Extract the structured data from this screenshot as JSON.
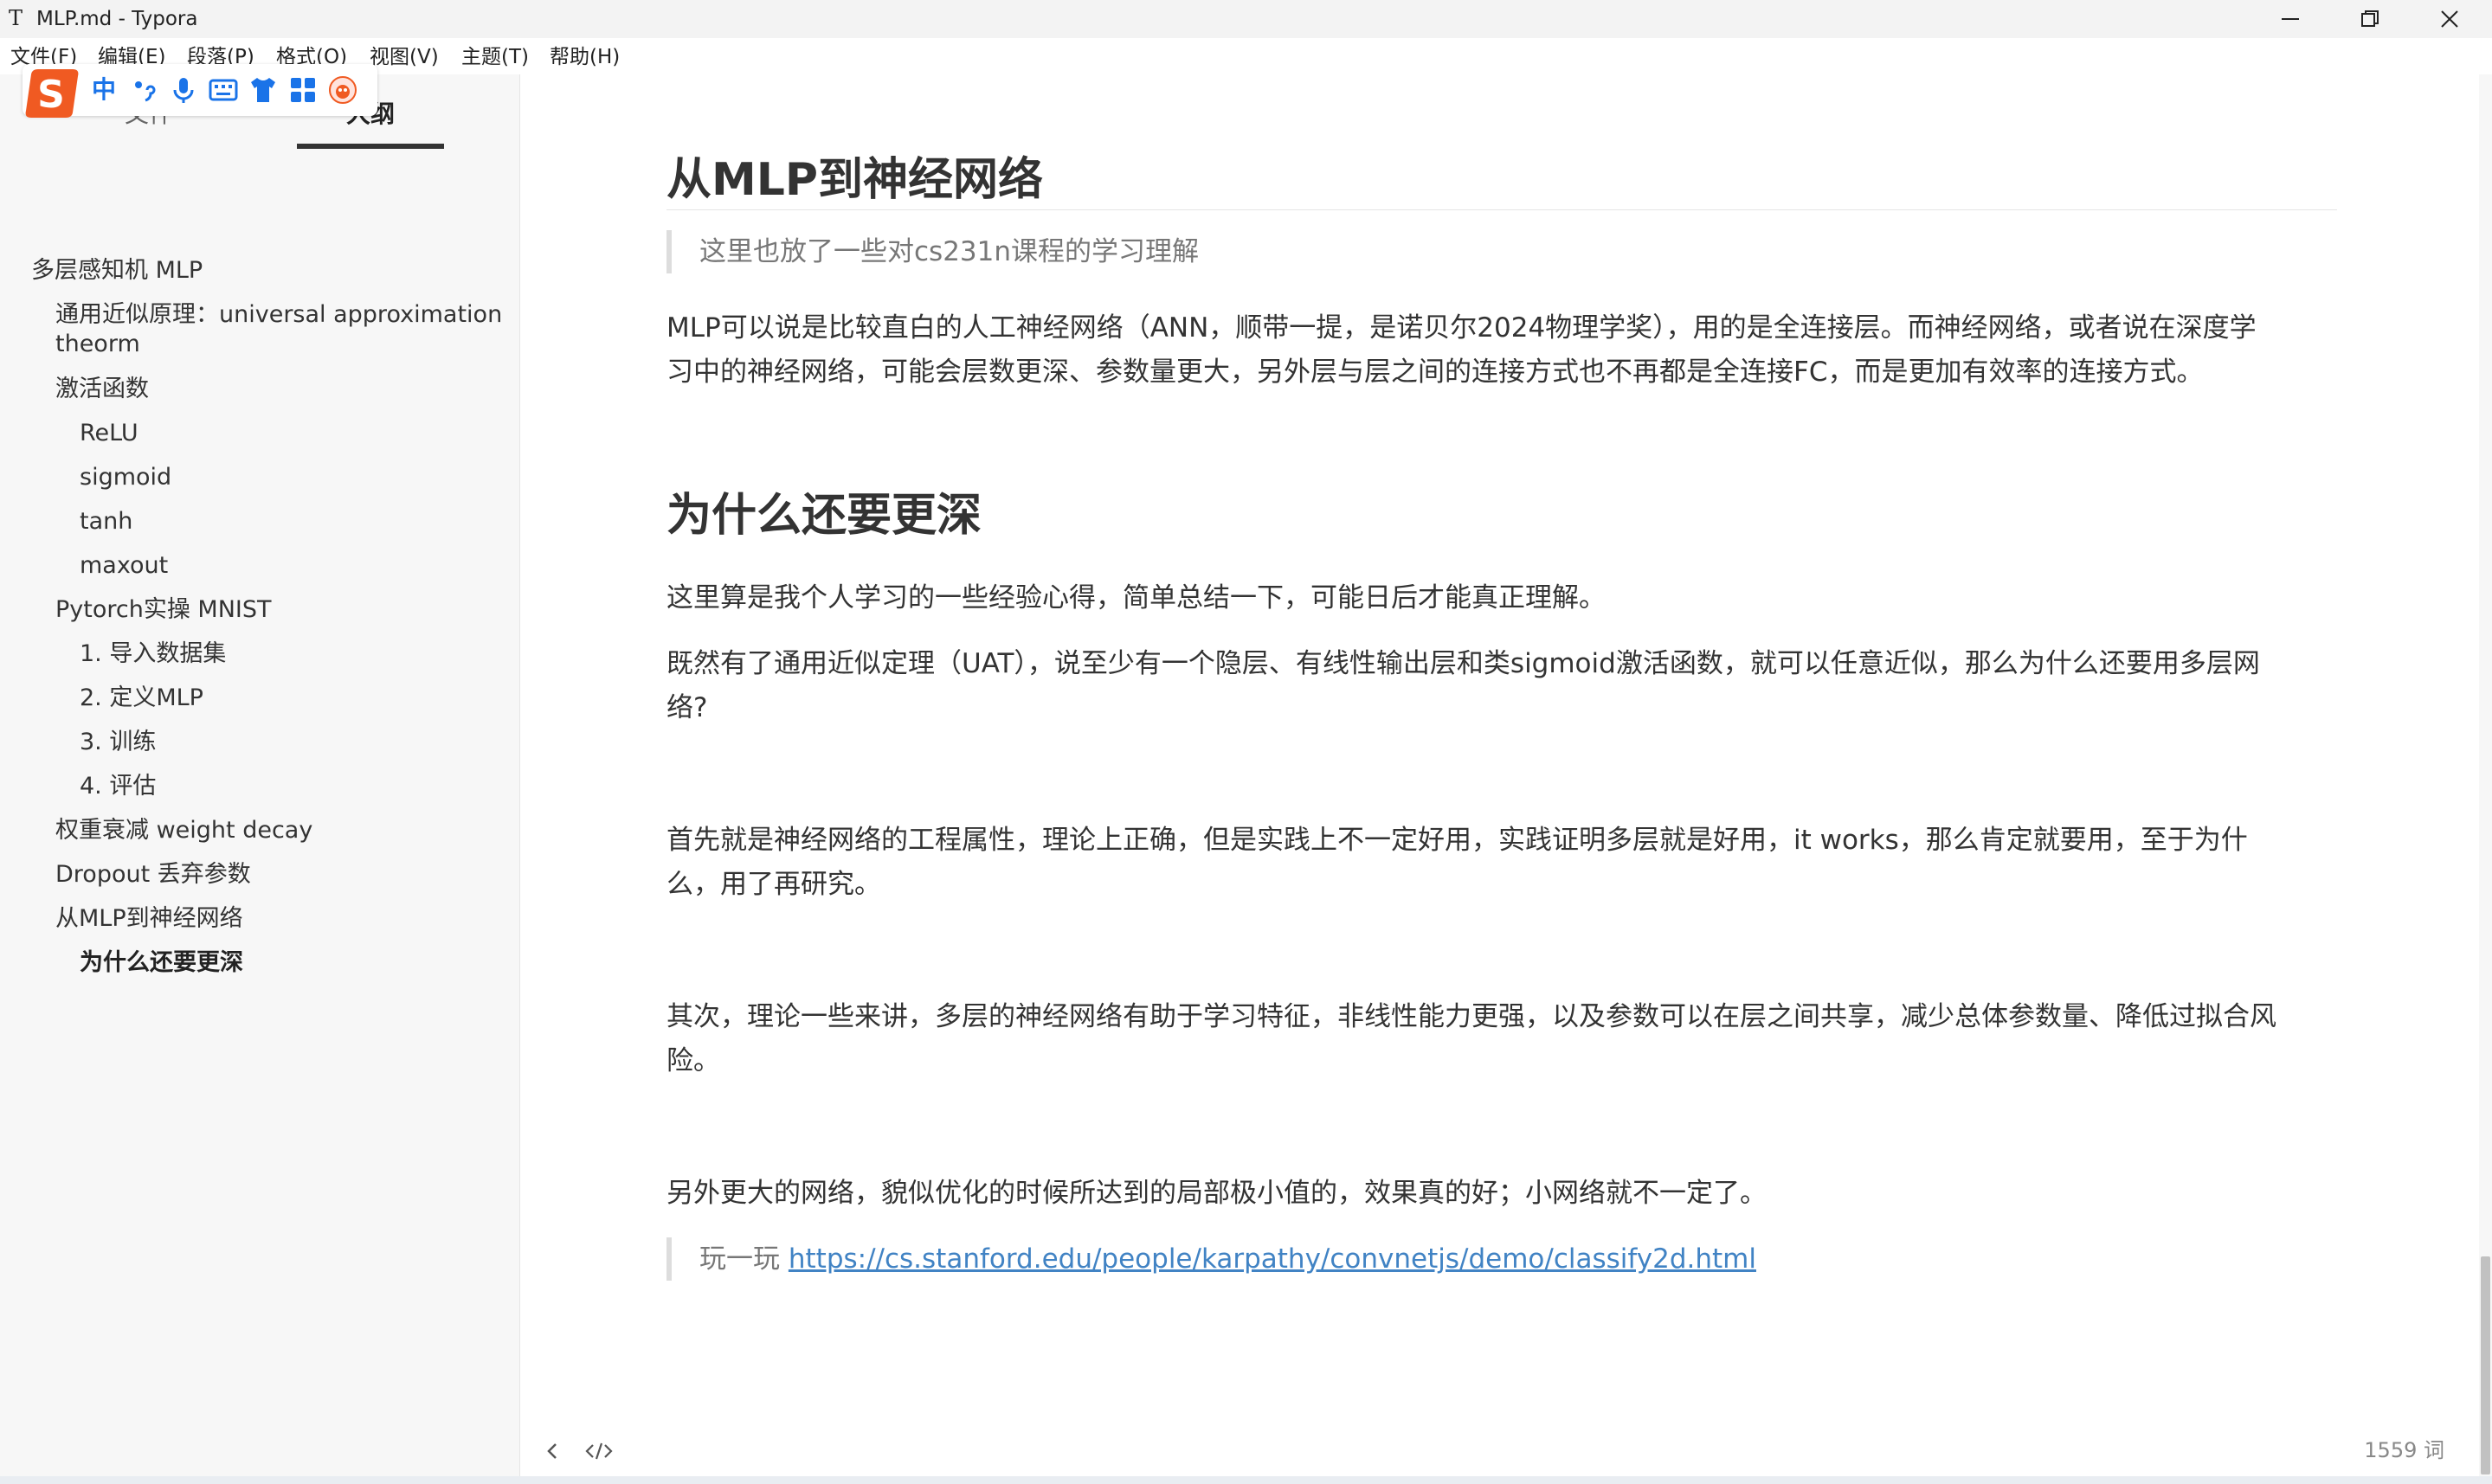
{
  "window": {
    "title": "MLP.md - Typora",
    "app_icon": "T"
  },
  "menu": [
    {
      "label": "文件(F)"
    },
    {
      "label": "编辑(E)"
    },
    {
      "label": "段落(P)"
    },
    {
      "label": "格式(O)"
    },
    {
      "label": "视图(V)"
    },
    {
      "label": "主题(T)"
    },
    {
      "label": "帮助(H)"
    }
  ],
  "ime": {
    "mode_label": "中",
    "icons": [
      "sogou-logo-icon",
      "punctuation-icon",
      "microphone-icon",
      "keyboard-icon",
      "skin-icon",
      "toolbox-icon",
      "mascot-icon"
    ]
  },
  "sidebar": {
    "tabs": [
      {
        "label": "文件",
        "active": false
      },
      {
        "label": "大纲",
        "active": true
      }
    ],
    "outline": [
      {
        "label": "多层感知机 MLP",
        "level": 1
      },
      {
        "label": "通用近似原理：universal approximation theorm",
        "level": 2
      },
      {
        "label": "激活函数",
        "level": 2
      },
      {
        "label": "ReLU",
        "level": 3
      },
      {
        "label": "sigmoid",
        "level": 3
      },
      {
        "label": "tanh",
        "level": 3
      },
      {
        "label": "maxout",
        "level": 3
      },
      {
        "label": "Pytorch实操 MNIST",
        "level": 2
      },
      {
        "label": "1. 导入数据集",
        "level": 3
      },
      {
        "label": "2. 定义MLP",
        "level": 3
      },
      {
        "label": "3. 训练",
        "level": 3
      },
      {
        "label": "4. 评估",
        "level": 3
      },
      {
        "label": "权重衰减 weight decay",
        "level": 2
      },
      {
        "label": "Dropout 丢弃参数",
        "level": 2
      },
      {
        "label": "从MLP到神经网络",
        "level": 2
      },
      {
        "label": "为什么还要更深",
        "level": 3,
        "active": true
      }
    ]
  },
  "document": {
    "h_mlp": "从MLP到神经网络",
    "quote1": "这里也放了一些对cs231n课程的学习理解",
    "p1_l1": "MLP可以说是比较直白的人工神经网络（ANN，顺带一提，是诺贝尔2024物理学奖），用的是全连接层。而神经网络，或者说在深度学",
    "p1_l2": "习中的神经网络，可能会层数更深、参数量更大，另外层与层之间的连接方式也不再都是全连接FC，而是更加有效率的连接方式。",
    "h_deeper": "为什么还要更深",
    "p2": "这里算是我个人学习的一些经验心得，简单总结一下，可能日后才能真正理解。",
    "p3_l1": "既然有了通用近似定理（UAT），说至少有一个隐层、有线性输出层和类sigmoid激活函数，就可以任意近似，那么为什么还要用多层网",
    "p3_l2": "络?",
    "p4_l1": "首先就是神经网络的工程属性，理论上正确，但是实践上不一定好用，实践证明多层就是好用，it works，那么肯定就要用，至于为什",
    "p4_l2": "么，用了再研究。",
    "p5_l1": "其次，理论一些来讲，多层的神经网络有助于学习特征，非线性能力更强，以及参数可以在层之间共享，减少总体参数量、降低过拟合风",
    "p5_l2": "险。",
    "p6": "另外更大的网络，貌似优化的时候所达到的局部极小值的，效果真的好；小网络就不一定了。",
    "quote2_prefix": "玩一玩 ",
    "quote2_link": "https://cs.stanford.edu/people/karpathy/convnetjs/demo/classify2d.html"
  },
  "footer": {
    "word_count": "1559 词"
  },
  "colors": {
    "link": "#4183c4",
    "sidebar_bg": "#f7f7f7",
    "ime_accent": "#1a73e8",
    "sogou_orange": "#f05a22"
  }
}
